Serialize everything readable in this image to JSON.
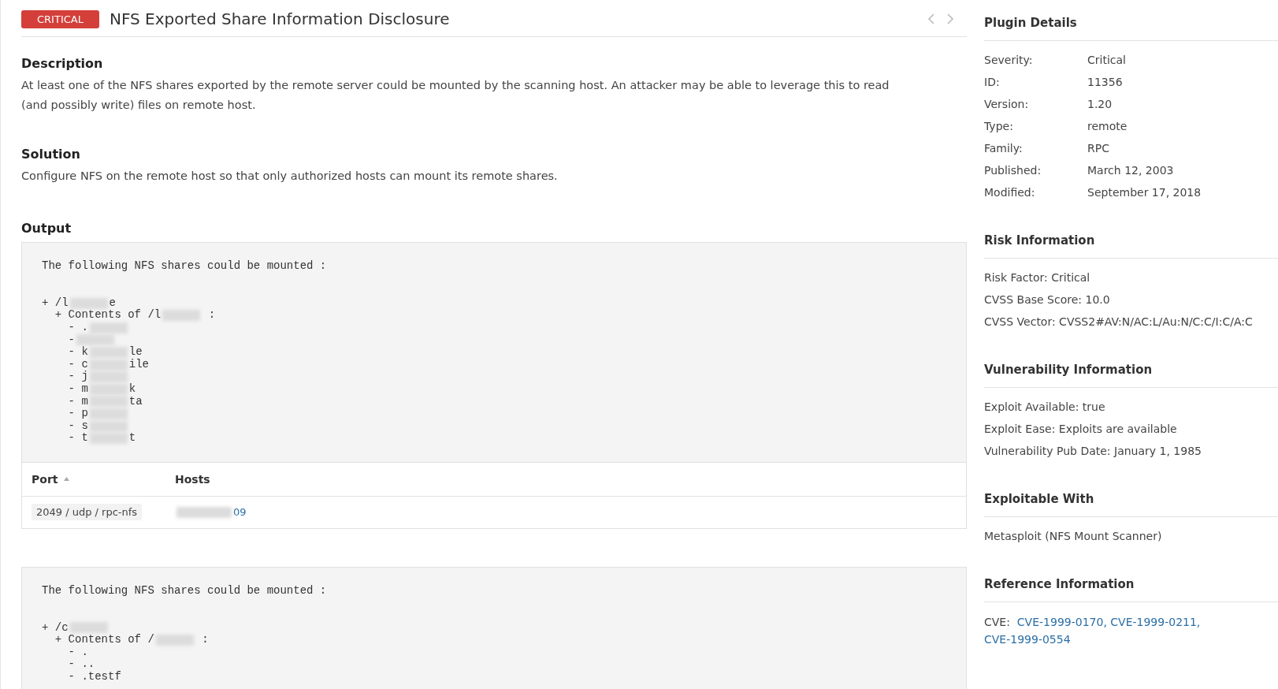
{
  "header": {
    "severity": "CRITICAL",
    "title": "NFS Exported Share Information Disclosure"
  },
  "sections": [
    {
      "heading": "Description",
      "text": "At least one of the NFS shares exported by the remote server could be mounted by the scanning host. An attacker may be able to leverage this to read (and possibly write) files on remote host."
    },
    {
      "heading": "Solution",
      "text": "Configure NFS on the remote host so that only authorized hosts can mount its remote shares."
    }
  ],
  "output": {
    "heading": "Output",
    "blocks": [
      {
        "intro": "The following NFS shares could be mounted :",
        "lines": [
          {
            "text": "+ /l",
            "redacted": true,
            "rest": "e"
          },
          {
            "text": "  + Contents of /l",
            "redacted": true,
            "rest": " :"
          },
          {
            "text": "    - .",
            "redacted": true
          },
          {
            "text": "    -",
            "redacted": true
          },
          {
            "text": "    - k",
            "redacted": true,
            "rest": "le"
          },
          {
            "text": "    - c",
            "redacted": true,
            "rest": "ile"
          },
          {
            "text": "    - j",
            "redacted": true
          },
          {
            "text": "    - m",
            "redacted": true,
            "rest": "k"
          },
          {
            "text": "    - m",
            "redacted": true,
            "rest": "ta"
          },
          {
            "text": "    - p",
            "redacted": true
          },
          {
            "text": "    - s",
            "redacted": true
          },
          {
            "text": "    - t",
            "redacted": true,
            "rest": "t"
          }
        ],
        "table": {
          "columns": [
            {
              "label": "Port",
              "sorted": true
            },
            {
              "label": "Hosts",
              "sorted": false
            }
          ],
          "rows": [
            {
              "port": "2049 / udp / rpc-nfs",
              "host": "09",
              "host_redacted": true
            }
          ]
        }
      },
      {
        "intro": "The following NFS shares could be mounted :",
        "lines": [
          {
            "text": "+ /c",
            "redacted": true
          },
          {
            "text": "  + Contents of /",
            "redacted": true,
            "rest": " :"
          },
          {
            "text": "    - ."
          },
          {
            "text": "    - .."
          },
          {
            "text": "    - .testf"
          }
        ]
      }
    ]
  },
  "sidebar": [
    {
      "heading": "Plugin Details",
      "kind": "pairs",
      "items": [
        {
          "label": "Severity:",
          "value": "Critical"
        },
        {
          "label": "ID:",
          "value": "11356"
        },
        {
          "label": "Version:",
          "value": "1.20"
        },
        {
          "label": "Type:",
          "value": "remote"
        },
        {
          "label": "Family:",
          "value": "RPC"
        },
        {
          "label": "Published:",
          "value": "March 12, 2003"
        },
        {
          "label": "Modified:",
          "value": "September 17, 2018"
        }
      ]
    },
    {
      "heading": "Risk Information",
      "kind": "lines",
      "items": [
        "Risk Factor: Critical",
        "CVSS Base Score: 10.0",
        "CVSS Vector: CVSS2#AV:N/AC:L/Au:N/C:C/I:C/A:C"
      ]
    },
    {
      "heading": "Vulnerability Information",
      "kind": "lines",
      "items": [
        "Exploit Available: true",
        "Exploit Ease: Exploits are available",
        "Vulnerability Pub Date: January 1, 1985"
      ]
    },
    {
      "heading": "Exploitable With",
      "kind": "lines",
      "items": [
        "Metasploit (NFS Mount Scanner)"
      ]
    },
    {
      "heading": "Reference Information",
      "kind": "refs",
      "label": "CVE:",
      "links": [
        "CVE-1999-0170,",
        "CVE-1999-0211,",
        "CVE-1999-0554"
      ]
    }
  ]
}
